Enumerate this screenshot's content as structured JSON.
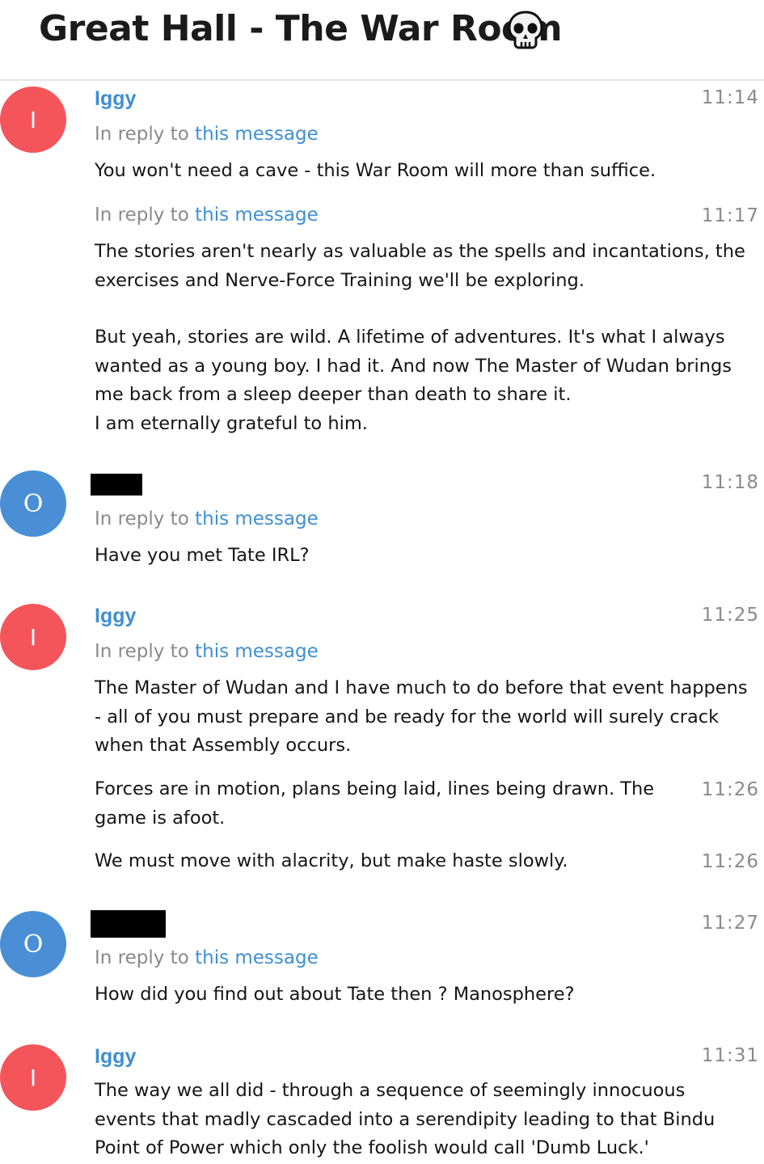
{
  "header": {
    "title": "Great Hall - The War Room",
    "title_icon": "skull-emoji-icon"
  },
  "colors": {
    "link": "#3f8fd2",
    "avatar_red": "#f3555a",
    "avatar_blue": "#4a8fd6",
    "timestamp": "#8a8a8a"
  },
  "messages": [
    {
      "avatar": "I",
      "sender": "Iggy",
      "time": "11:14",
      "reply_prefix": "In reply to",
      "reply_link": "this message",
      "text": "You won't need a cave - this War Room will more than suffice."
    },
    {
      "time": "11:17",
      "reply_prefix": "In reply to",
      "reply_link": "this message",
      "paragraphs": [
        "The stories aren't nearly as valuable as the spells and incantations, the exercises and Nerve-Force Training we'll be exploring.",
        "But yeah, stories are wild. A lifetime of adventures. It's what I always wanted as a young boy. I had it. And now The Master of Wudan brings me back from a sleep deeper than death to share it.",
        "I am eternally grateful to him."
      ]
    },
    {
      "avatar": "O",
      "sender_redacted": true,
      "time": "11:18",
      "reply_prefix": "In reply to",
      "reply_link": "this message",
      "text": "Have you met Tate IRL?"
    },
    {
      "avatar": "I",
      "sender": "Iggy",
      "time": "11:25",
      "reply_prefix": "In reply to",
      "reply_link": "this message",
      "text": "The Master of Wudan and I have much to do before that event happens - all of you must prepare and be ready for the world will surely crack when that Assembly occurs."
    },
    {
      "time": "11:26",
      "text": "Forces are in motion, plans being laid, lines being drawn. The game is afoot."
    },
    {
      "time": "11:26",
      "text": "We must move with alacrity, but make haste slowly."
    },
    {
      "avatar": "O",
      "sender_redacted": true,
      "time": "11:27",
      "reply_prefix": "In reply to",
      "reply_link": "this message",
      "text": "How did you find out about Tate then ? Manosphere?"
    },
    {
      "avatar": "I",
      "sender": "Iggy",
      "time": "11:31",
      "text": "The way we all did - through a sequence of seemingly innocuous events that madly cascaded into a serendipity leading to that Bindu Point of Power which only the foolish would call 'Dumb Luck.'"
    }
  ]
}
